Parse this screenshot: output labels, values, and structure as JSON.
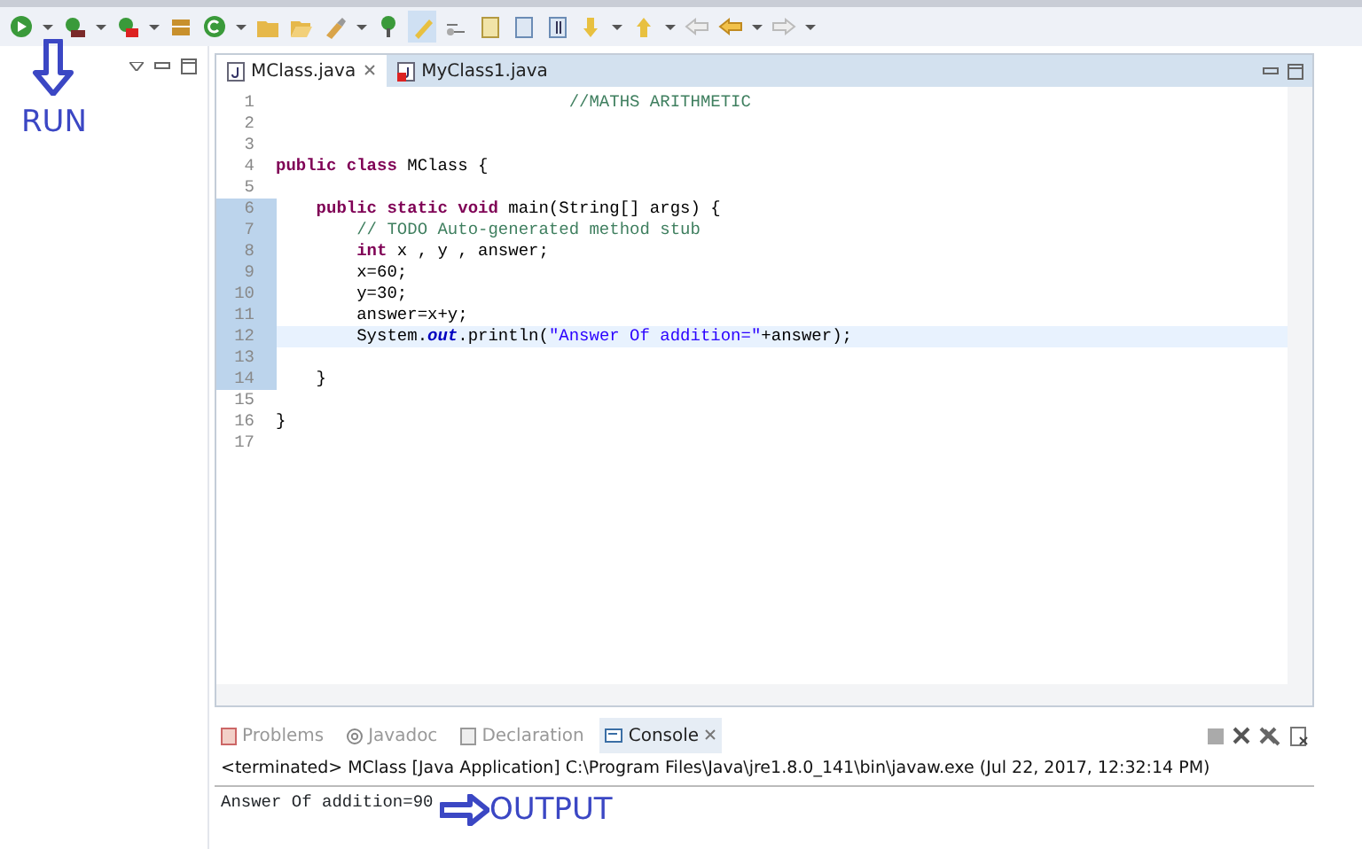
{
  "annotations": [
    {
      "text": "RUN",
      "kind": "down"
    },
    {
      "text": "OUTPUT",
      "kind": "right"
    }
  ],
  "editor": {
    "tabs": [
      {
        "label": "MClass.java",
        "selected": true,
        "error": false
      },
      {
        "label": "MyClass1.java",
        "selected": false,
        "error": true
      }
    ],
    "lines": [
      {
        "number": "1",
        "changed": false,
        "current": false,
        "foldable": false,
        "segments": [
          {
            "kind": "comment",
            "text": "                             //MATHS ARITHMETIC"
          }
        ]
      },
      {
        "number": "2",
        "changed": false,
        "current": false,
        "foldable": false
      },
      {
        "number": "3",
        "changed": false,
        "current": false,
        "foldable": false
      },
      {
        "number": "4",
        "changed": false,
        "current": false,
        "foldable": false,
        "segments": [
          {
            "kind": "keyword",
            "text": "public class"
          },
          {
            "kind": "plain",
            "text": " MClass {"
          }
        ]
      },
      {
        "number": "5",
        "changed": false,
        "current": false,
        "foldable": false
      },
      {
        "number": "6",
        "changed": true,
        "current": false,
        "foldable": true,
        "segments": [
          {
            "kind": "keyword",
            "text": "    public static void"
          },
          {
            "kind": "plain",
            "text": " main(String[] args) {"
          }
        ]
      },
      {
        "number": "7",
        "changed": true,
        "current": false,
        "foldable": false,
        "segments": [
          {
            "kind": "comment",
            "text": "        // TODO Auto-generated method stub"
          }
        ]
      },
      {
        "number": "8",
        "changed": true,
        "current": false,
        "foldable": false,
        "segments": [
          {
            "kind": "keyword",
            "text": "        int"
          },
          {
            "kind": "plain",
            "text": " x , y , answer;"
          }
        ]
      },
      {
        "number": "9",
        "changed": true,
        "current": false,
        "foldable": false,
        "segments": [
          {
            "kind": "plain",
            "text": "        x=60;"
          }
        ]
      },
      {
        "number": "10",
        "changed": true,
        "current": false,
        "foldable": false,
        "segments": [
          {
            "kind": "plain",
            "text": "        y=30;"
          }
        ]
      },
      {
        "number": "11",
        "changed": true,
        "current": false,
        "foldable": false,
        "segments": [
          {
            "kind": "plain",
            "text": "        answer=x+y;"
          }
        ]
      },
      {
        "number": "12",
        "changed": true,
        "current": true,
        "foldable": false,
        "segments": [
          {
            "kind": "plain",
            "text": "        System."
          },
          {
            "kind": "field",
            "text": "out"
          },
          {
            "kind": "plain",
            "text": ".println("
          },
          {
            "kind": "string",
            "text": "\"Answer Of addition=\""
          },
          {
            "kind": "plain",
            "text": "+answer);"
          }
        ]
      },
      {
        "number": "13",
        "changed": true,
        "current": false,
        "foldable": false
      },
      {
        "number": "14",
        "changed": true,
        "current": false,
        "foldable": false,
        "segments": [
          {
            "kind": "plain",
            "text": "    }"
          }
        ]
      },
      {
        "number": "15",
        "changed": false,
        "current": false,
        "foldable": false
      },
      {
        "number": "16",
        "changed": false,
        "current": false,
        "foldable": false,
        "segments": [
          {
            "kind": "plain",
            "text": "}"
          }
        ]
      },
      {
        "number": "17",
        "changed": false,
        "current": false,
        "foldable": false
      }
    ]
  },
  "console_panel": {
    "tabs": [
      {
        "label": "Problems",
        "selected": false
      },
      {
        "label": "Javadoc",
        "selected": false
      },
      {
        "label": "Declaration",
        "selected": false
      },
      {
        "label": "Console",
        "selected": true
      }
    ],
    "header": "<terminated> MClass [Java Application] C:\\Program Files\\Java\\jre1.8.0_141\\bin\\javaw.exe (Jul 22, 2017, 12:32:14 PM)",
    "output": [
      "Answer Of addition=90"
    ]
  }
}
